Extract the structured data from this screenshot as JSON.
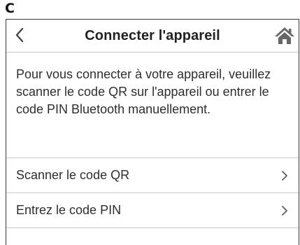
{
  "figure_label": "C",
  "header": {
    "title": "Connecter l'appareil",
    "back_icon": "chevron-left-icon",
    "home_icon": "home-icon"
  },
  "instructions": "Pour vous connecter à votre appareil, veuillez scanner le code QR sur l'appareil ou entrer le code PIN Bluetooth manuellement.",
  "menu": {
    "items": [
      {
        "label": "Scanner le code QR",
        "icon": "chevron-right-icon"
      },
      {
        "label": "Entrez le code PIN",
        "icon": "chevron-right-icon"
      }
    ]
  },
  "colors": {
    "text": "#2e2e2e",
    "divider": "#c8c8c8",
    "frame_border": "#3a3a3a",
    "icon": "#555555"
  }
}
